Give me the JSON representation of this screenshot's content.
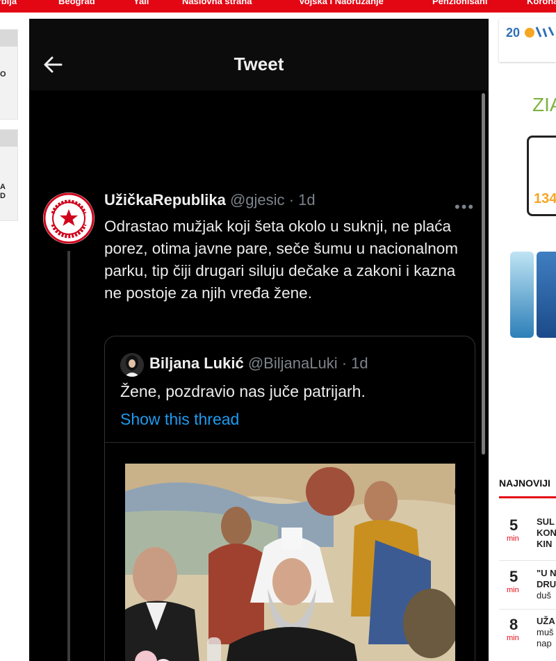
{
  "nav": {
    "items": [
      "Srbija",
      "Beograd",
      "Yall",
      "Naslovna strana",
      "Vojska i Naoružanje",
      "Penzionisani",
      "Korona"
    ]
  },
  "left_sidebar": {
    "box1_text": "O",
    "box2_text": "A\nD"
  },
  "tweet": {
    "header_title": "Tweet",
    "author_name": "UžičkaRepublika",
    "author_handle": "@gjesic",
    "time": "· 1d",
    "body": "Odrastao mužjak koji šeta okolo u suknji, ne plaća porez, otima javne pare, seče šumu u nacionalnom parku, tip čiji drugari siluju dečake a zakoni i kazna ne postoje za njih vređa žene.",
    "avatar_text": "УЖИЧКА РЕПУБЛИКА",
    "quote": {
      "author_name": "Biljana Lukić",
      "author_handle": "@BiljanaLuki",
      "time": "· 1d",
      "text": "Žene, pozdravio nas juče patrijarh.",
      "link": "Show this thread"
    }
  },
  "right_column": {
    "ad_logo": "20",
    "ad_brand": "ZIA",
    "ad_price": "134",
    "news_title": "NAJNOVIJI",
    "news": [
      {
        "num": "5",
        "unit": "min",
        "lines": [
          "SUL",
          "KON",
          "KIN"
        ]
      },
      {
        "num": "5",
        "unit": "min",
        "lines": [
          "\"U N",
          "DRU",
          "duš"
        ]
      },
      {
        "num": "8",
        "unit": "min",
        "lines": [
          "UŽA",
          "muš",
          "nap"
        ]
      }
    ]
  },
  "colors": {
    "brand_red": "#e30613",
    "tweet_bg": "#000000",
    "link_blue": "#1d9bf0",
    "muted": "#7c838a"
  }
}
